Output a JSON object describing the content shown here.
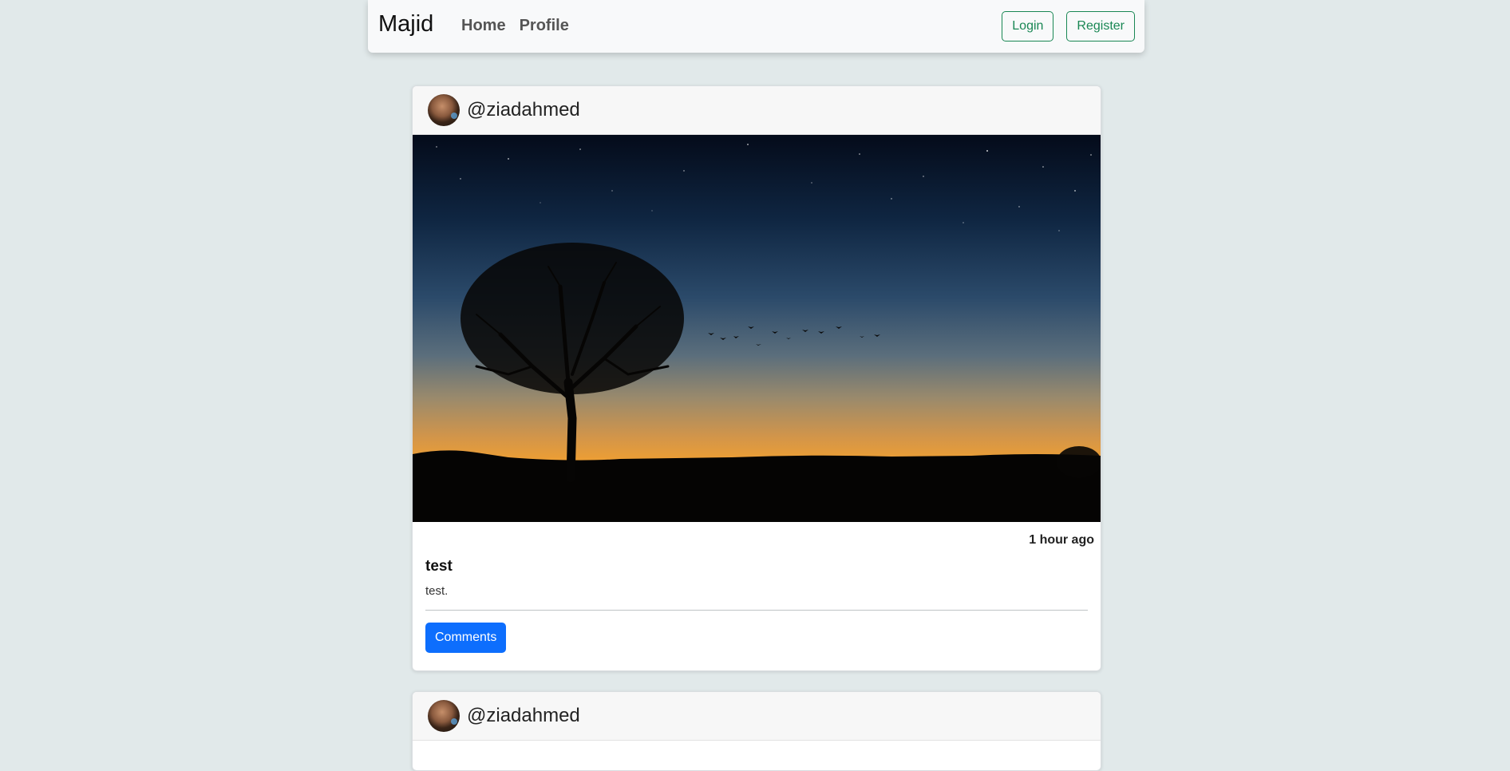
{
  "navbar": {
    "brand": "Majid",
    "links": [
      {
        "label": "Home"
      },
      {
        "label": "Profile"
      }
    ],
    "login_label": "Login",
    "register_label": "Register",
    "accent_color": "#198754"
  },
  "posts": [
    {
      "username": "@ziadahmed",
      "timestamp": "1 hour ago",
      "title": "test",
      "text": "test.",
      "comments_label": "Comments",
      "image": "sunset-tree-silhouette"
    },
    {
      "username": "@ziadahmed"
    }
  ],
  "colors": {
    "background": "#e1e9ea",
    "primary_button": "#0d6efd"
  }
}
